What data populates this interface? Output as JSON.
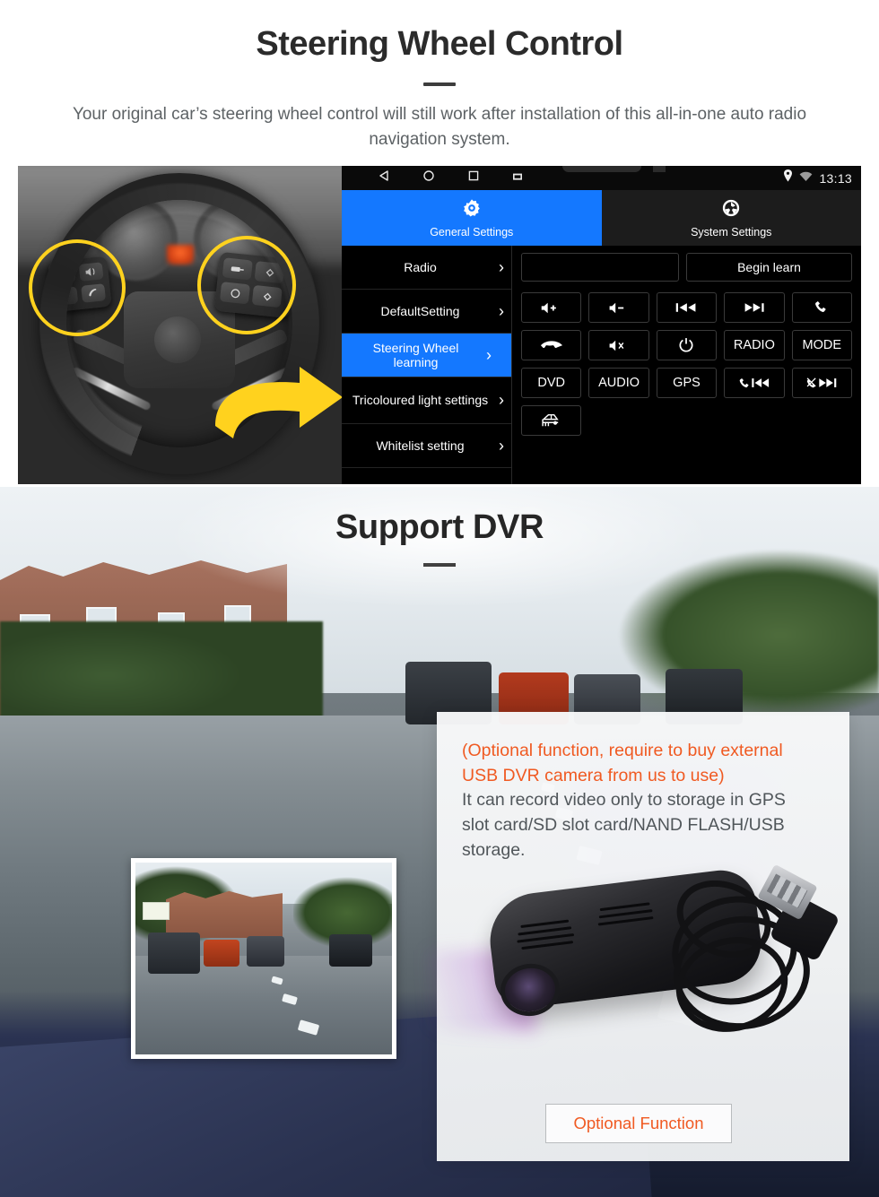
{
  "section1": {
    "title": "Steering Wheel Control",
    "subtitle": "Your original car’s steering wheel control will still work after installation of this all-in-one auto radio navigation system.",
    "photo_alt": "steering-wheel-with-controls"
  },
  "head_unit": {
    "statusbar": {
      "nav_icons": [
        "back-icon",
        "home-icon",
        "recents-icon",
        "screenshot-icon"
      ],
      "location_icon": "location-pin-icon",
      "wifi_icon": "wifi-icon",
      "time": "13:13"
    },
    "tabs": [
      {
        "label": "General Settings",
        "icon": "gear-icon",
        "active": true
      },
      {
        "label": "System Settings",
        "icon": "aperture-icon",
        "active": false
      }
    ],
    "menu": [
      {
        "label": "Radio",
        "active": false
      },
      {
        "label": "DefaultSetting",
        "active": false
      },
      {
        "label": "Steering Wheel learning",
        "active": true
      },
      {
        "label": "Tricoloured light settings",
        "active": false
      },
      {
        "label": "Whitelist setting",
        "active": false
      }
    ],
    "chevron": "›",
    "readout_value": "",
    "begin_learn_label": "Begin learn",
    "keys": [
      {
        "label": "",
        "icon": "volume-up-icon",
        "name": "key-volume-up"
      },
      {
        "label": "",
        "icon": "volume-down-icon",
        "name": "key-volume-down"
      },
      {
        "label": "",
        "icon": "previous-track-icon",
        "name": "key-previous"
      },
      {
        "label": "",
        "icon": "next-track-icon",
        "name": "key-next"
      },
      {
        "label": "",
        "icon": "phone-answer-icon",
        "name": "key-answer-call"
      },
      {
        "label": "",
        "icon": "phone-hangup-icon",
        "name": "key-hangup-call"
      },
      {
        "label": "",
        "icon": "mute-icon",
        "name": "key-mute"
      },
      {
        "label": "",
        "icon": "power-icon",
        "name": "key-power"
      },
      {
        "label": "RADIO",
        "icon": "",
        "name": "key-radio"
      },
      {
        "label": "MODE",
        "icon": "",
        "name": "key-mode"
      },
      {
        "label": "DVD",
        "icon": "",
        "name": "key-dvd"
      },
      {
        "label": "AUDIO",
        "icon": "",
        "name": "key-audio"
      },
      {
        "label": "GPS",
        "icon": "",
        "name": "key-gps"
      },
      {
        "label": "",
        "icon": "phone-previous-icon",
        "name": "key-call-previous"
      },
      {
        "label": "",
        "icon": "phone-reject-next-icon",
        "name": "key-reject-next"
      },
      {
        "label": "",
        "icon": "car-icon",
        "name": "key-car"
      }
    ]
  },
  "section2": {
    "title": "Support DVR",
    "photo_alt": "dashcam-street-view",
    "inset_alt": "dvr-recorded-video-thumbnail",
    "card": {
      "highlight_line_1": "(Optional function, require to buy external",
      "highlight_line_2": "USB DVR camera from us to use)",
      "body_line_1": "It can record video only to storage in GPS",
      "body_line_2": "slot card/SD slot card/NAND FLASH/USB",
      "body_line_3": "storage.",
      "product_alt": "usb-dvr-camera-with-cable",
      "button_label": "Optional Function"
    }
  },
  "colors": {
    "accent_blue": "#1478ff",
    "accent_orange": "#f05a22",
    "highlight_yellow": "#FFD21E",
    "dark_text": "#2b2b2b",
    "muted_text": "#5d6265"
  }
}
